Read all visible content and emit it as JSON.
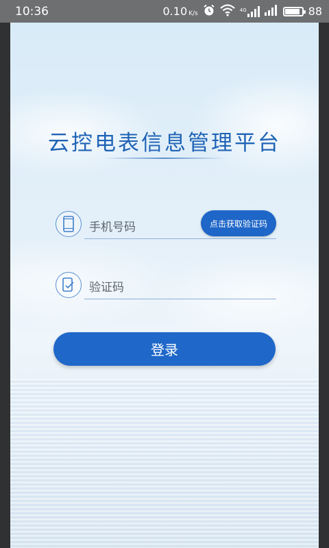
{
  "status_bar": {
    "time": "10:36",
    "speed": "0.10",
    "speed_unit": "K/s",
    "network_tag": "4G",
    "battery": "88",
    "battery_level": 0.88,
    "icons": [
      "alarm-icon",
      "wifi-icon",
      "signal-4g-icon",
      "signal-icon",
      "battery-icon"
    ]
  },
  "app": {
    "title": "云控电表信息管理平台"
  },
  "form": {
    "phone_placeholder": "手机号码",
    "get_code_label": "点击获取验证码",
    "code_placeholder": "验证码",
    "login_label": "登录"
  },
  "colors": {
    "accent": "#1f68c9",
    "title": "#1f63b5"
  }
}
